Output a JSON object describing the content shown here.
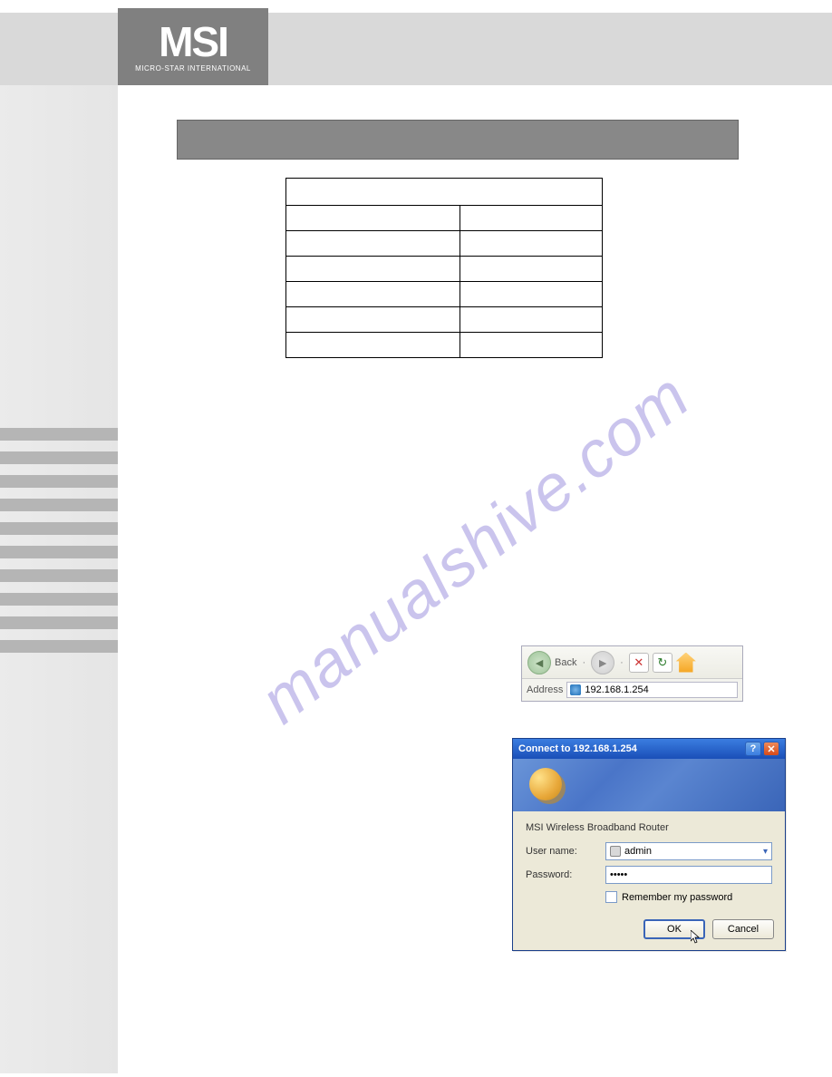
{
  "logo": {
    "brand": "MSI",
    "tagline": "MICRO-STAR INTERNATIONAL"
  },
  "watermark": "manualshive.com",
  "ie_toolbar": {
    "back_label": "Back",
    "address_label": "Address",
    "address_value": "192.168.1.254"
  },
  "dialog": {
    "title": "Connect to 192.168.1.254",
    "subtitle": "MSI Wireless Broadband Router",
    "username_label": "User name:",
    "username_value": "admin",
    "password_label": "Password:",
    "password_value": "•••••",
    "remember_label": "Remember my password",
    "ok_label": "OK",
    "cancel_label": "Cancel"
  }
}
